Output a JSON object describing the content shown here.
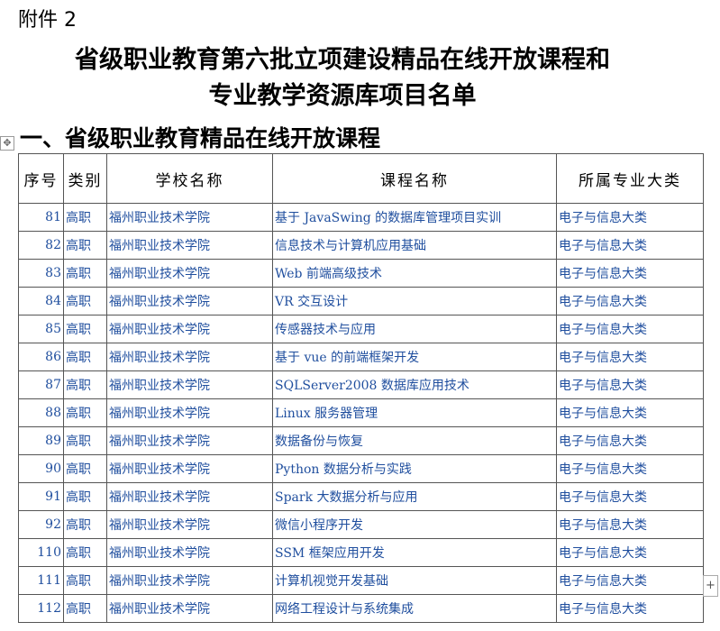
{
  "header": {
    "attachment": "附件 2",
    "title_line1": "省级职业教育第六批立项建设精品在线开放课程和",
    "title_line2": "专业教学资源库项目名单",
    "section_heading": "一、省级职业教育精品在线开放课程"
  },
  "table": {
    "headers": [
      "序号",
      "类别",
      "学校名称",
      "课程名称",
      "所属专业大类"
    ],
    "rows": [
      {
        "no": "81",
        "type": "高职",
        "school": "福州职业技术学院",
        "course": "基于 JavaSwing 的数据库管理项目实训",
        "major": "电子与信息大类"
      },
      {
        "no": "82",
        "type": "高职",
        "school": "福州职业技术学院",
        "course": "信息技术与计算机应用基础",
        "major": "电子与信息大类"
      },
      {
        "no": "83",
        "type": "高职",
        "school": "福州职业技术学院",
        "course": "Web 前端高级技术",
        "major": "电子与信息大类"
      },
      {
        "no": "84",
        "type": "高职",
        "school": "福州职业技术学院",
        "course": "VR 交互设计",
        "major": "电子与信息大类"
      },
      {
        "no": "85",
        "type": "高职",
        "school": "福州职业技术学院",
        "course": "传感器技术与应用",
        "major": "电子与信息大类"
      },
      {
        "no": "86",
        "type": "高职",
        "school": "福州职业技术学院",
        "course": "基于 vue 的前端框架开发",
        "major": "电子与信息大类"
      },
      {
        "no": "87",
        "type": "高职",
        "school": "福州职业技术学院",
        "course": "SQLServer2008 数据库应用技术",
        "major": "电子与信息大类"
      },
      {
        "no": "88",
        "type": "高职",
        "school": "福州职业技术学院",
        "course": "Linux 服务器管理",
        "major": "电子与信息大类"
      },
      {
        "no": "89",
        "type": "高职",
        "school": "福州职业技术学院",
        "course": "数据备份与恢复",
        "major": "电子与信息大类"
      },
      {
        "no": "90",
        "type": "高职",
        "school": "福州职业技术学院",
        "course": "Python 数据分析与实践",
        "major": "电子与信息大类"
      },
      {
        "no": "91",
        "type": "高职",
        "school": "福州职业技术学院",
        "course": "Spark 大数据分析与应用",
        "major": "电子与信息大类"
      },
      {
        "no": "92",
        "type": "高职",
        "school": "福州职业技术学院",
        "course": "微信小程序开发",
        "major": "电子与信息大类"
      },
      {
        "no": "110",
        "type": "高职",
        "school": "福州职业技术学院",
        "course": "SSM 框架应用开发",
        "major": "电子与信息大类"
      },
      {
        "no": "111",
        "type": "高职",
        "school": "福州职业技术学院",
        "course": "计算机视觉开发基础",
        "major": "电子与信息大类"
      },
      {
        "no": "112",
        "type": "高职",
        "school": "福州职业技术学院",
        "course": "网络工程设计与系统集成",
        "major": "电子与信息大类"
      }
    ]
  },
  "icons": {
    "move_handle": "move-arrows-icon",
    "add_row": "plus-icon"
  }
}
